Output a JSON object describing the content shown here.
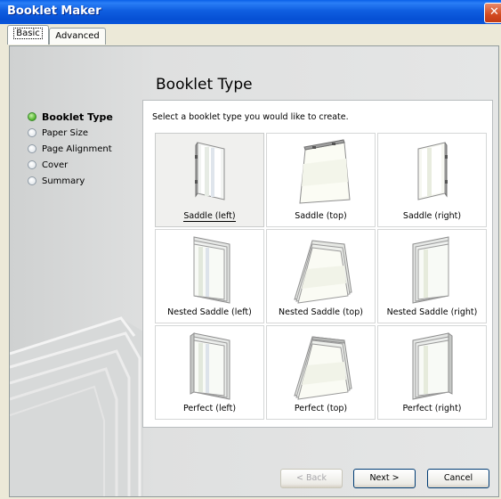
{
  "window": {
    "title": "Booklet Maker",
    "close_glyph": "✕"
  },
  "tabs": [
    {
      "label": "Basic",
      "active": true
    },
    {
      "label": "Advanced",
      "active": false
    }
  ],
  "steps": [
    {
      "label": "Booklet Type",
      "active": true
    },
    {
      "label": "Paper Size",
      "active": false
    },
    {
      "label": "Page Alignment",
      "active": false
    },
    {
      "label": "Cover",
      "active": false
    },
    {
      "label": "Summary",
      "active": false
    }
  ],
  "page": {
    "heading": "Booklet Type",
    "instruction": "Select a booklet type you would like to create."
  },
  "options": [
    {
      "label": "Saddle (left)",
      "icon": "saddle-left-icon",
      "selected": true
    },
    {
      "label": "Saddle (top)",
      "icon": "saddle-top-icon",
      "selected": false
    },
    {
      "label": "Saddle (right)",
      "icon": "saddle-right-icon",
      "selected": false
    },
    {
      "label": "Nested Saddle (left)",
      "icon": "nested-saddle-left-icon",
      "selected": false
    },
    {
      "label": "Nested Saddle (top)",
      "icon": "nested-saddle-top-icon",
      "selected": false
    },
    {
      "label": "Nested Saddle (right)",
      "icon": "nested-saddle-right-icon",
      "selected": false
    },
    {
      "label": "Perfect (left)",
      "icon": "perfect-left-icon",
      "selected": false
    },
    {
      "label": "Perfect (top)",
      "icon": "perfect-top-icon",
      "selected": false
    },
    {
      "label": "Perfect (right)",
      "icon": "perfect-right-icon",
      "selected": false
    }
  ],
  "buttons": {
    "back": "< Back",
    "next": "Next >",
    "cancel": "Cancel"
  },
  "colors": {
    "titlebar": "#0a56db",
    "active_step": "#4fb32a",
    "window_bg": "#ece9d8"
  }
}
